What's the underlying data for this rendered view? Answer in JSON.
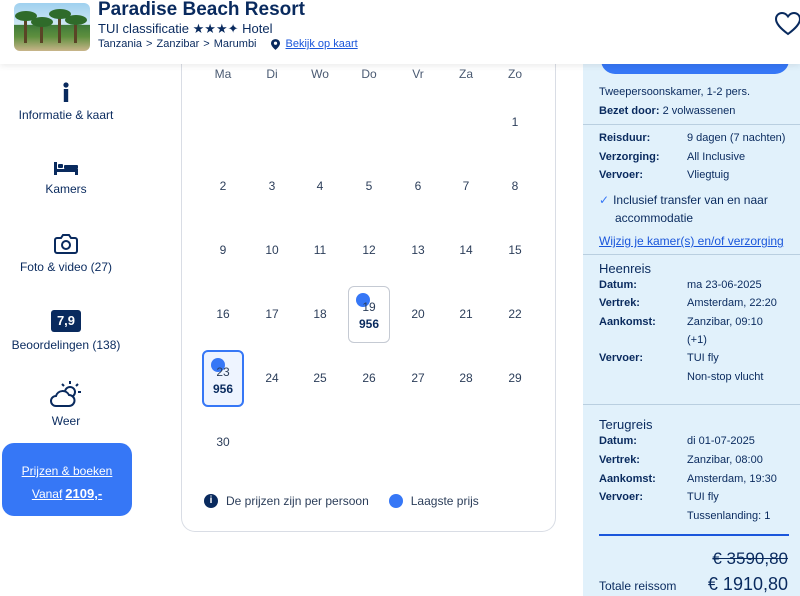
{
  "header": {
    "title": "Paradise Beach Resort",
    "classification": "TUI classificatie",
    "stars": "★★★✦",
    "type": "Hotel",
    "breadcrumbs": [
      "Tanzania",
      "Zanzibar",
      "Marumbi"
    ],
    "separator": ">",
    "map_link": "Bekijk op kaart"
  },
  "sidebar": {
    "info": "Informatie & kaart",
    "rooms": "Kamers",
    "photos": "Foto & video (27)",
    "rating": "7,9",
    "reviews": "Beoordelingen (138)",
    "weather": "Weer",
    "cta_line1": "Prijzen & boeken",
    "cta_from": "Vanaf",
    "cta_price": "2109,-"
  },
  "calendar": {
    "weekdays": [
      "Ma",
      "Di",
      "Wo",
      "Do",
      "Vr",
      "Za",
      "Zo"
    ],
    "days": [
      "1",
      "2",
      "3",
      "4",
      "5",
      "6",
      "7",
      "8",
      "9",
      "10",
      "11",
      "12",
      "13",
      "14",
      "15",
      "16",
      "17",
      "18",
      "19",
      "20",
      "21",
      "22",
      "23",
      "24",
      "25",
      "26",
      "27",
      "28",
      "29",
      "30"
    ],
    "price_cells": [
      {
        "day": "19",
        "price": "956"
      },
      {
        "day": "23",
        "price": "956"
      }
    ],
    "legend_note": "De prijzen zijn per persoon",
    "legend_lowest": "Laagste prijs"
  },
  "summary": {
    "room": "Tweepersoonskamer, 1-2 pers.",
    "occupied_label": "Bezet door:",
    "occupied_value": "2 volwassenen",
    "duration_label": "Reisduur:",
    "duration_value": "9 dagen (7 nachten)",
    "board_label": "Verzorging:",
    "board_value": "All Inclusive",
    "transport_label": "Vervoer:",
    "transport_value": "Vliegtuig",
    "transfer_line1": "Inclusief transfer van en naar",
    "transfer_line2": "accommodatie",
    "change_link": "Wijzig je kamer(s) en/of verzorging",
    "outbound": {
      "title": "Heenreis",
      "date_label": "Datum:",
      "date": "ma 23-06-2025",
      "dep_label": "Vertrek:",
      "dep": "Amsterdam, 22:20",
      "arr_label": "Aankomst:",
      "arr": "Zanzibar, 09:10",
      "arr_note": "(+1)",
      "carrier_label": "Vervoer:",
      "carrier": "TUI fly",
      "flight_note": "Non-stop vlucht"
    },
    "return": {
      "title": "Terugreis",
      "date_label": "Datum:",
      "date": "di 01-07-2025",
      "dep_label": "Vertrek:",
      "dep": "Zanzibar, 08:00",
      "arr_label": "Aankomst:",
      "arr": "Amsterdam, 19:30",
      "carrier_label": "Vervoer:",
      "carrier": "TUI fly",
      "flight_note": "Tussenlanding: 1"
    },
    "old_price": "€ 3590,80",
    "total_label": "Totale reissom",
    "total_value": "€ 1910,80"
  },
  "colors": {
    "navy": "#092a5e",
    "accent": "#3677f6",
    "panel": "#e1f1fb"
  }
}
